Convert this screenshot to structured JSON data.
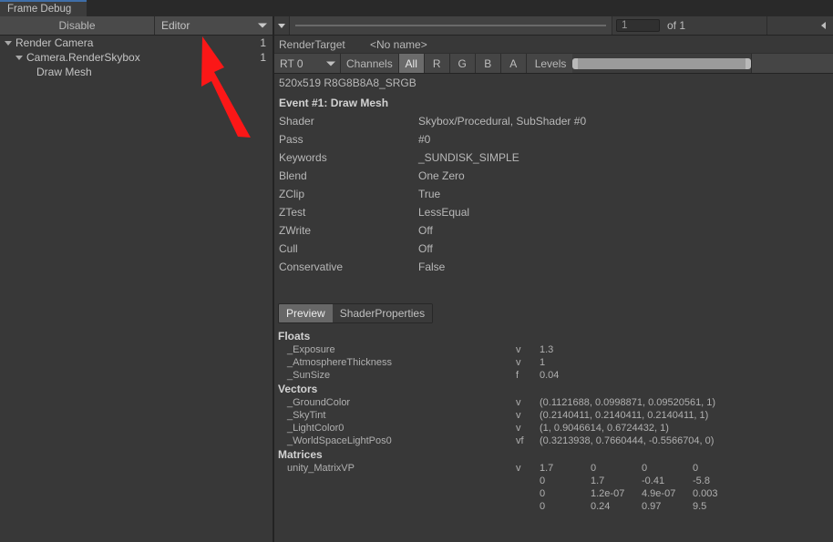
{
  "window": {
    "tab_label": "Frame Debug",
    "accent_color": "#3f6ea8"
  },
  "left_panel": {
    "disable_button": "Disable",
    "target_dropdown": "Editor",
    "tree": [
      {
        "label": "Render Camera",
        "count": "1",
        "indent": 0,
        "has_arrow": true
      },
      {
        "label": "Camera.RenderSkybox",
        "count": "1",
        "indent": 1,
        "has_arrow": true
      },
      {
        "label": "Draw Mesh",
        "count": "",
        "indent": 2,
        "has_arrow": false
      }
    ]
  },
  "event_bar": {
    "event_number": "1",
    "event_total": "of 1"
  },
  "render_target": {
    "label": "RenderTarget",
    "name": "<No name>",
    "rt_dropdown": "RT 0",
    "channels_label": "Channels",
    "channels": [
      {
        "label": "All",
        "selected": true
      },
      {
        "label": "R",
        "selected": false
      },
      {
        "label": "G",
        "selected": false
      },
      {
        "label": "B",
        "selected": false
      },
      {
        "label": "A",
        "selected": false
      }
    ],
    "levels_label": "Levels",
    "format": "520x519 R8G8B8A8_SRGB"
  },
  "event_details": {
    "title": "Event #1: Draw Mesh",
    "rows": [
      {
        "key": "Shader",
        "value": "Skybox/Procedural, SubShader #0"
      },
      {
        "key": "Pass",
        "value": "#0"
      },
      {
        "key": "Keywords",
        "value": "_SUNDISK_SIMPLE"
      },
      {
        "key": "Blend",
        "value": "One Zero"
      },
      {
        "key": "ZClip",
        "value": "True"
      },
      {
        "key": "ZTest",
        "value": "LessEqual"
      },
      {
        "key": "ZWrite",
        "value": "Off"
      },
      {
        "key": "Cull",
        "value": "Off"
      },
      {
        "key": "Conservative",
        "value": "False"
      }
    ]
  },
  "sub_tabs": [
    {
      "label": "Preview",
      "selected": true
    },
    {
      "label": "ShaderProperties",
      "selected": false
    }
  ],
  "shader_properties": {
    "floats_header": "Floats",
    "floats": [
      {
        "name": "_Exposure",
        "type": "v",
        "value": "1.3"
      },
      {
        "name": "_AtmosphereThickness",
        "type": "v",
        "value": "1"
      },
      {
        "name": "_SunSize",
        "type": "f",
        "value": "0.04"
      }
    ],
    "vectors_header": "Vectors",
    "vectors": [
      {
        "name": "_GroundColor",
        "type": "v",
        "value": "(0.1121688, 0.0998871, 0.09520561, 1)"
      },
      {
        "name": "_SkyTint",
        "type": "v",
        "value": "(0.2140411, 0.2140411, 0.2140411, 1)"
      },
      {
        "name": "_LightColor0",
        "type": "v",
        "value": "(1, 0.9046614, 0.6724432, 1)"
      },
      {
        "name": "_WorldSpaceLightPos0",
        "type": "vf",
        "value": "(0.3213938, 0.7660444, -0.5566704, 0)"
      }
    ],
    "matrices_header": "Matrices",
    "matrices": [
      {
        "name": "unity_MatrixVP",
        "type": "v",
        "rows": [
          [
            "1.7",
            "0",
            "0",
            "0"
          ],
          [
            "0",
            "1.7",
            "-0.41",
            "-5.8"
          ],
          [
            "0",
            "1.2e-07",
            "4.9e-07",
            "0.003"
          ],
          [
            "0",
            "0.24",
            "0.97",
            "9.5"
          ]
        ]
      }
    ]
  },
  "annotation": {
    "arrow_color": "#fb1717"
  }
}
